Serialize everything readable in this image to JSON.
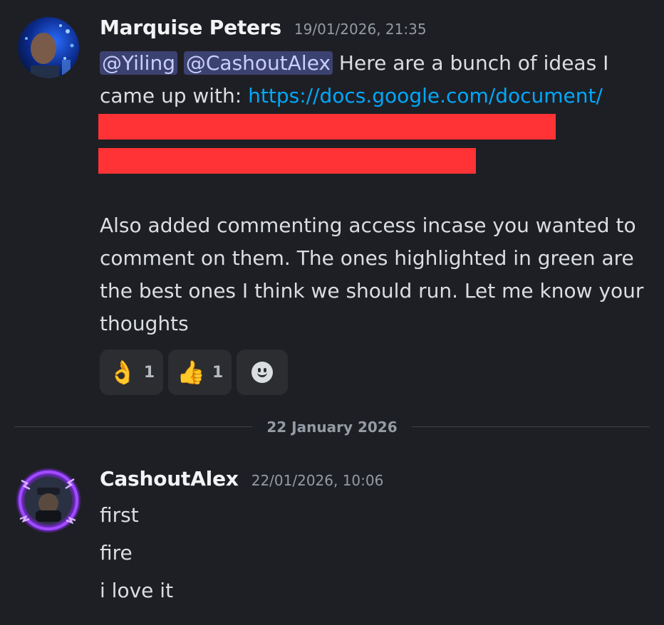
{
  "messages": [
    {
      "author": "Marquise Peters",
      "timestamp": "19/01/2026, 21:35",
      "mentions": [
        "@Yiling",
        "@CashoutAlex"
      ],
      "text_after_mentions": " Here are a bunch of ideas I came up with: ",
      "link": "https://docs.google.com/document/",
      "paragraph2": "Also added commenting access incase you wanted to comment on them. The ones highlighted in green are the best ones I think we should run. Let me know your thoughts",
      "reactions": [
        {
          "emoji": "👌",
          "count": "1"
        },
        {
          "emoji": "👍",
          "count": "1"
        }
      ],
      "add_reaction_icon": "add-reaction-smiley-icon"
    },
    {
      "author": "CashoutAlex",
      "timestamp": "22/01/2026, 10:06",
      "lines": [
        "first",
        "fire",
        "i love it"
      ]
    }
  ],
  "date_divider": "22 January 2026",
  "colors": {
    "background": "#1e1f24",
    "mention_bg": "#3c4270",
    "link": "#00a8fc",
    "redaction": "#ff3336",
    "reaction_bg": "#2b2d31"
  }
}
